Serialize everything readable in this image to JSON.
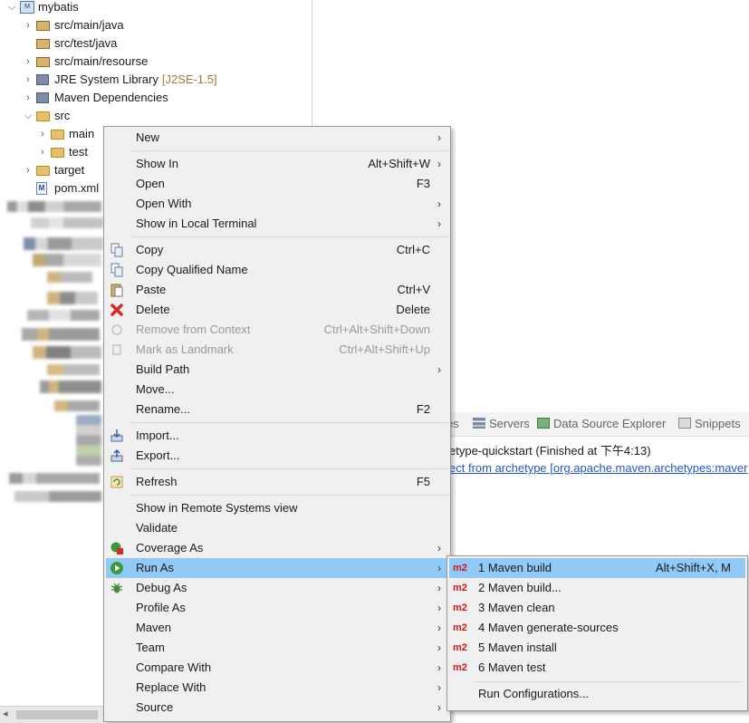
{
  "explorer": {
    "tree": [
      {
        "name": "mybatis",
        "icon": "maven-project-icon",
        "expanded": true
      },
      {
        "name": "src/main/java",
        "icon": "source-folder-icon",
        "expanded": false
      },
      {
        "name": "src/test/java",
        "icon": "source-folder-icon",
        "expanded": null
      },
      {
        "name": "src/main/resourse",
        "icon": "source-folder-icon",
        "expanded": false
      },
      {
        "name": "JRE System Library",
        "decoration": "[J2SE-1.5]",
        "icon": "library-icon",
        "expanded": false
      },
      {
        "name": "Maven Dependencies",
        "icon": "library-icon",
        "expanded": false
      },
      {
        "name": "src",
        "icon": "folder-icon",
        "expanded": true
      },
      {
        "name": "main",
        "icon": "folder-icon",
        "expanded": false
      },
      {
        "name": "test",
        "icon": "folder-icon",
        "expanded": false
      },
      {
        "name": "target",
        "icon": "folder-icon",
        "expanded": false
      },
      {
        "name": "pom.xml",
        "icon": "maven-pom-file-icon",
        "selected": true
      }
    ],
    "blurred_labels": [
      "Servers",
      "mybatis-web",
      "Deployed"
    ]
  },
  "console": {
    "tabs": [
      {
        "label": "es",
        "icon": "problems-icon"
      },
      {
        "label": "Servers",
        "icon": "servers-icon"
      },
      {
        "label": "Data Source Explorer",
        "icon": "data-source-explorer-icon"
      },
      {
        "label": "Snippets",
        "icon": "snippets-icon"
      }
    ],
    "line1": "etype-quickstart (Finished at 下午4:13)",
    "line2": "ect from archetype [org.apache.maven.archetypes:maver"
  },
  "context_menu": {
    "items": [
      {
        "label": "New",
        "shortcut": "",
        "submenu": true
      },
      {
        "label": "Show In",
        "shortcut": "Alt+Shift+W",
        "submenu": true
      },
      {
        "label": "Open",
        "shortcut": "F3",
        "submenu": false
      },
      {
        "label": "Open With",
        "shortcut": "",
        "submenu": true
      },
      {
        "label": "Show in Local Terminal",
        "shortcut": "",
        "submenu": true
      },
      {
        "label": "Copy",
        "shortcut": "Ctrl+C",
        "submenu": false,
        "icon": "copy-icon"
      },
      {
        "label": "Copy Qualified Name",
        "shortcut": "",
        "submenu": false,
        "icon": "copy-qualified-name-icon"
      },
      {
        "label": "Paste",
        "shortcut": "Ctrl+V",
        "submenu": false,
        "icon": "paste-icon"
      },
      {
        "label": "Delete",
        "shortcut": "Delete",
        "submenu": false,
        "icon": "delete-icon"
      },
      {
        "label": "Remove from Context",
        "shortcut": "Ctrl+Alt+Shift+Down",
        "submenu": false,
        "disabled": true,
        "icon": "remove-context-icon"
      },
      {
        "label": "Mark as Landmark",
        "shortcut": "Ctrl+Alt+Shift+Up",
        "submenu": false,
        "disabled": true,
        "icon": "landmark-icon"
      },
      {
        "label": "Build Path",
        "shortcut": "",
        "submenu": true
      },
      {
        "label": "Move...",
        "shortcut": "",
        "submenu": false
      },
      {
        "label": "Rename...",
        "shortcut": "F2",
        "submenu": false
      },
      {
        "label": "Import...",
        "shortcut": "",
        "submenu": false,
        "icon": "import-icon"
      },
      {
        "label": "Export...",
        "shortcut": "",
        "submenu": false,
        "icon": "export-icon"
      },
      {
        "label": "Refresh",
        "shortcut": "F5",
        "submenu": false,
        "icon": "refresh-icon"
      },
      {
        "label": "Show in Remote Systems view",
        "shortcut": "",
        "submenu": false
      },
      {
        "label": "Validate",
        "shortcut": "",
        "submenu": false
      },
      {
        "label": "Coverage As",
        "shortcut": "",
        "submenu": true,
        "icon": "coverage-icon"
      },
      {
        "label": "Run As",
        "shortcut": "",
        "submenu": true,
        "highlighted": true,
        "icon": "run-icon"
      },
      {
        "label": "Debug As",
        "shortcut": "",
        "submenu": true,
        "icon": "debug-icon"
      },
      {
        "label": "Profile As",
        "shortcut": "",
        "submenu": true
      },
      {
        "label": "Maven",
        "shortcut": "",
        "submenu": true
      },
      {
        "label": "Team",
        "shortcut": "",
        "submenu": true
      },
      {
        "label": "Compare With",
        "shortcut": "",
        "submenu": true
      },
      {
        "label": "Replace With",
        "shortcut": "",
        "submenu": true
      },
      {
        "label": "Source",
        "shortcut": "",
        "submenu": true
      }
    ]
  },
  "run_as_submenu": {
    "badge": "m2",
    "items": [
      {
        "label": "1 Maven build",
        "shortcut": "Alt+Shift+X, M",
        "highlighted": true
      },
      {
        "label": "2 Maven build...",
        "shortcut": ""
      },
      {
        "label": "3 Maven clean",
        "shortcut": ""
      },
      {
        "label": "4 Maven generate-sources",
        "shortcut": ""
      },
      {
        "label": "5 Maven install",
        "shortcut": ""
      },
      {
        "label": "6 Maven test",
        "shortcut": ""
      }
    ],
    "footer": "Run Configurations..."
  },
  "colors": {
    "highlight": "#91c9f7",
    "menu_bg": "#f0f0f0",
    "link": "#2255cc",
    "m2_badge": "#d01818"
  }
}
